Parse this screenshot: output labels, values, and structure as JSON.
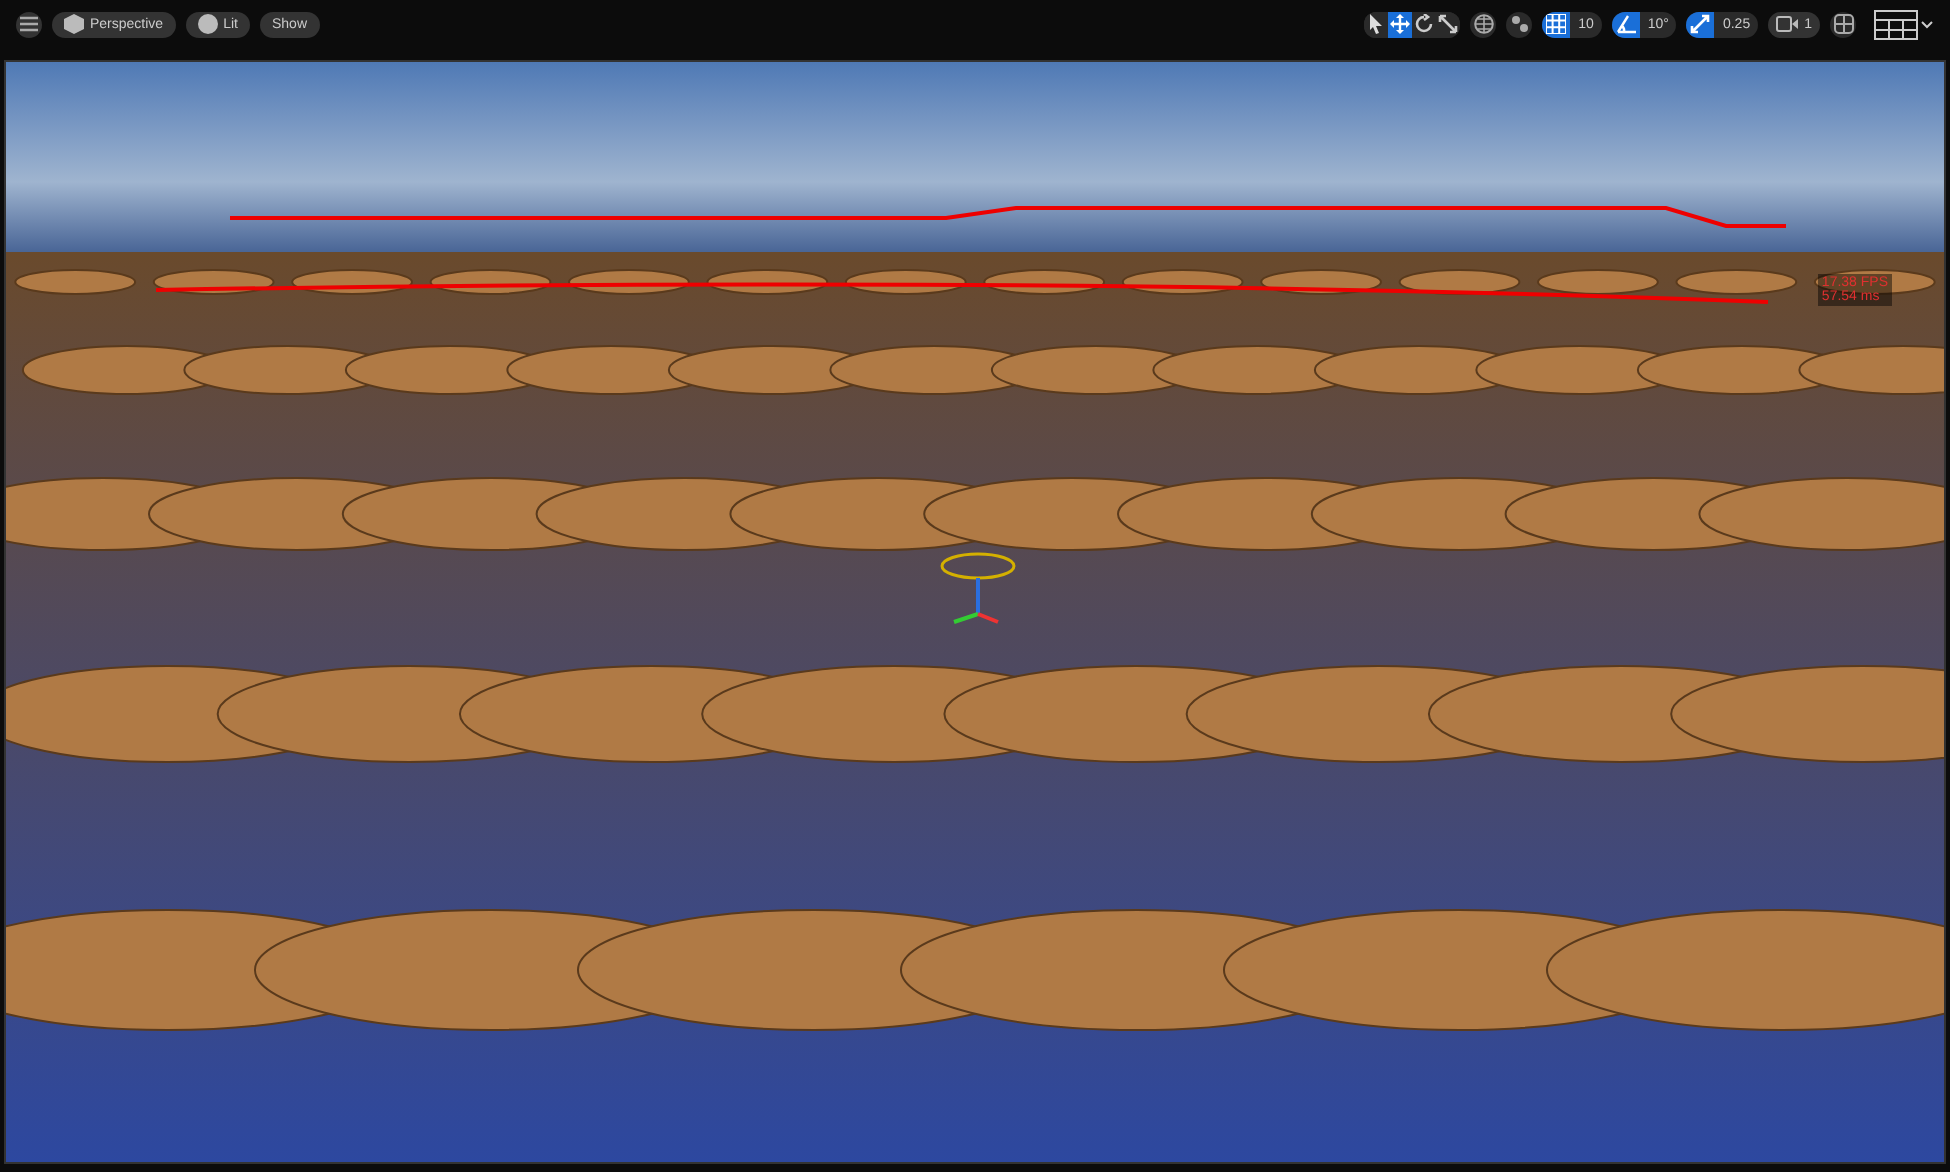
{
  "toolbar": {
    "left": [
      {
        "kind": "menu"
      },
      {
        "kind": "perspective",
        "label": "Perspective"
      },
      {
        "kind": "lit",
        "label": "Lit"
      },
      {
        "kind": "plain",
        "label": "Show"
      }
    ],
    "transform_tools": [
      {
        "kind": "select",
        "selected": false
      },
      {
        "kind": "move",
        "selected": true
      },
      {
        "kind": "rotate",
        "selected": false
      },
      {
        "kind": "scale",
        "selected": false
      }
    ],
    "snaps": [
      {
        "kind": "grid",
        "on": true,
        "value": "10"
      },
      {
        "kind": "rotation",
        "on": true,
        "value": "10°"
      },
      {
        "kind": "scale",
        "on": true,
        "value": "0.25"
      }
    ],
    "camera_speed": "1"
  },
  "stats": {
    "fps": "17.38 FPS",
    "frame_time": "57.54 ms"
  }
}
